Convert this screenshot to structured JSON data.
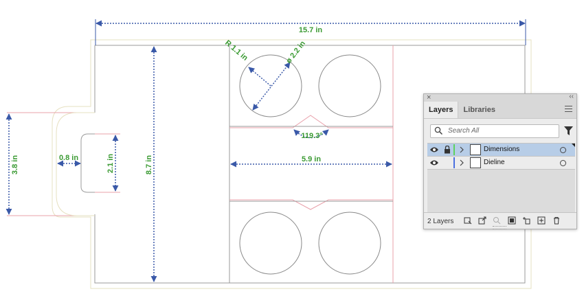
{
  "artboard": {
    "dimensions": {
      "overall_width": "15.7 in",
      "side_height": "3.8 in",
      "tab_gap": "0.8 in",
      "slot_height": "2.1 in",
      "body_height": "8.7 in",
      "radius": "R 1.1 in",
      "diameter": "ø 2.2 in",
      "angle": "119.3°",
      "inner_width": "5.9 in"
    },
    "colors": {
      "dimension_arrow": "#3a59a8",
      "dimension_text": "#3a9a32",
      "dieline_cut": "#e8a0aa",
      "outer_bleed": "#e6e0c0",
      "fold_line": "#8a8a8a"
    }
  },
  "layers_panel": {
    "close_glyph": "×",
    "collapse_glyph": "‹‹",
    "tabs": [
      {
        "label": "Layers",
        "active": true
      },
      {
        "label": "Libraries",
        "active": false
      }
    ],
    "search": {
      "placeholder": "Search All"
    },
    "layers": [
      {
        "name": "Dimensions",
        "color": "#5dd35d",
        "locked": true,
        "visible": true,
        "selected": true
      },
      {
        "name": "Dieline",
        "color": "#4a6fe0",
        "locked": false,
        "visible": true,
        "selected": false
      }
    ],
    "footer": {
      "count_label": "2 Layers"
    }
  }
}
